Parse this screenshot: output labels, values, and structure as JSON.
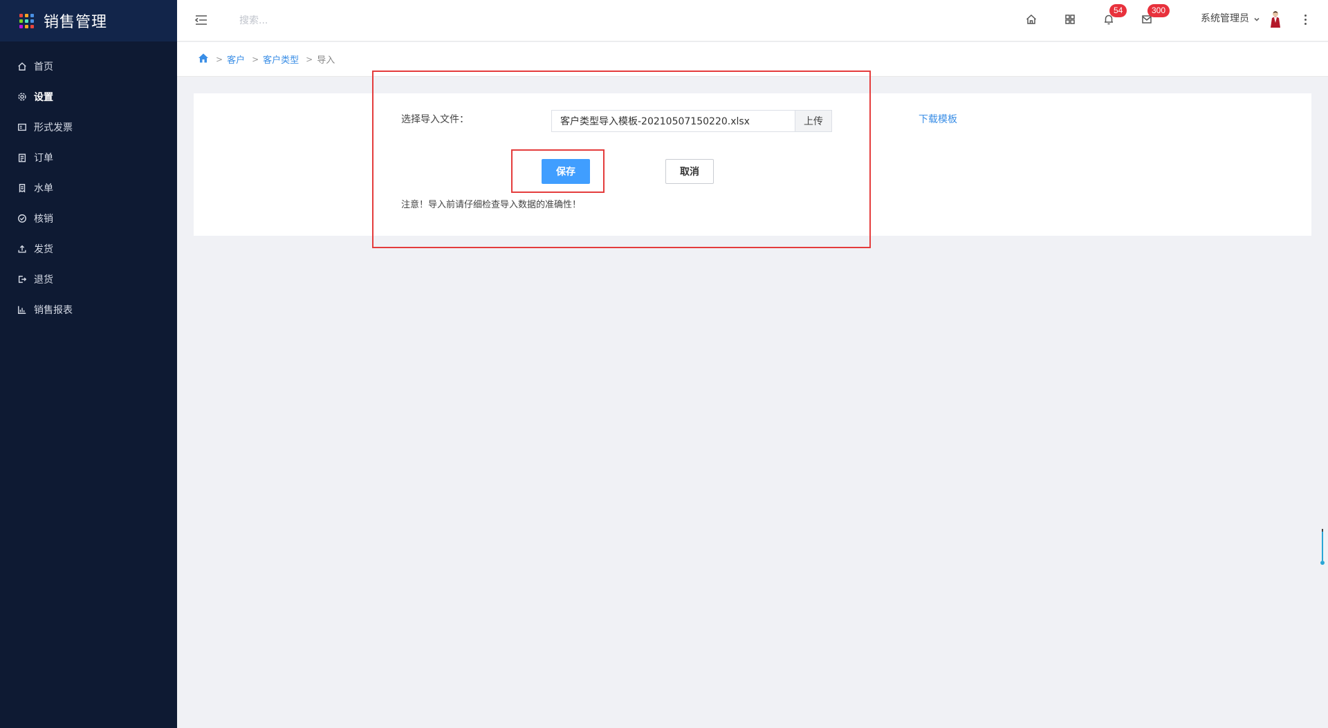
{
  "app": {
    "title": "销售管理"
  },
  "brand_dot_colors": [
    "#e8453c",
    "#f5a623",
    "#4a90e2",
    "#7ed321",
    "#50e3c2",
    "#4a90e2",
    "#bd10e0",
    "#f5a623",
    "#e8453c"
  ],
  "sidebar": {
    "items": [
      {
        "label": "首页",
        "icon": "home-icon"
      },
      {
        "label": "设置",
        "icon": "gear-icon"
      },
      {
        "label": "形式发票",
        "icon": "invoice-icon"
      },
      {
        "label": "订单",
        "icon": "clipboard-icon"
      },
      {
        "label": "水单",
        "icon": "receipt-icon"
      },
      {
        "label": "核销",
        "icon": "check-circle-icon"
      },
      {
        "label": "发货",
        "icon": "upload-icon"
      },
      {
        "label": "退货",
        "icon": "return-icon"
      },
      {
        "label": "销售报表",
        "icon": "bar-chart-icon"
      }
    ]
  },
  "header": {
    "search_placeholder": "搜索...",
    "notifications_count": "54",
    "messages_count": "300",
    "user_name": "系统管理员"
  },
  "breadcrumb": {
    "items": [
      "客户",
      "客户类型"
    ],
    "current": "导入",
    "separator": ">"
  },
  "import_form": {
    "file_label": "选择导入文件：",
    "file_value": "客户类型导入模板-20210507150220.xlsx",
    "upload_label": "上传",
    "download_label": "下载模板",
    "save_label": "保存",
    "cancel_label": "取消",
    "notice": "注意！导入前请仔细检查导入数据的准确性！"
  },
  "colors": {
    "sidebar_bg": "#0e1a33",
    "primary": "#409eff",
    "link": "#3a8ee6",
    "badge": "#e8313c",
    "annotation": "#e43b3b"
  }
}
